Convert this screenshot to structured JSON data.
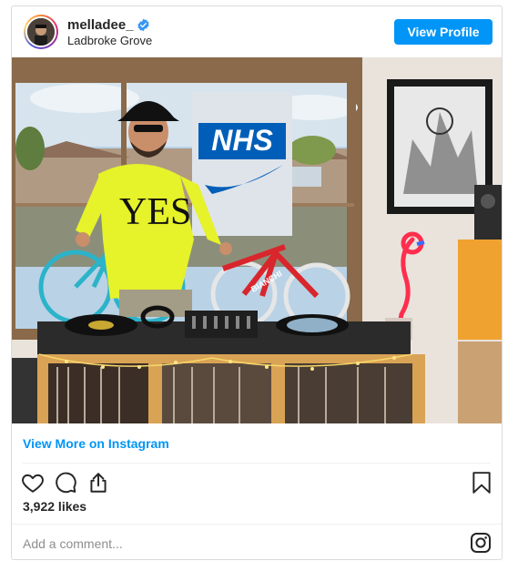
{
  "post": {
    "username": "melladee_",
    "location": "Ladbroke Grove",
    "view_profile_label": "View Profile",
    "view_more_label": "View More on Instagram",
    "likes": "3,922 likes",
    "comment_placeholder": "Add a comment...",
    "verified_icon": "verified-badge-icon",
    "brand_color": "#0095f6"
  },
  "photo": {
    "shirt_text": "YES",
    "poster_text": "NHS",
    "bike_text": "BIANCHI"
  },
  "actions": {
    "icons": [
      "heart-icon",
      "comment-icon",
      "share-icon",
      "bookmark-icon",
      "instagram-logo-icon"
    ]
  }
}
